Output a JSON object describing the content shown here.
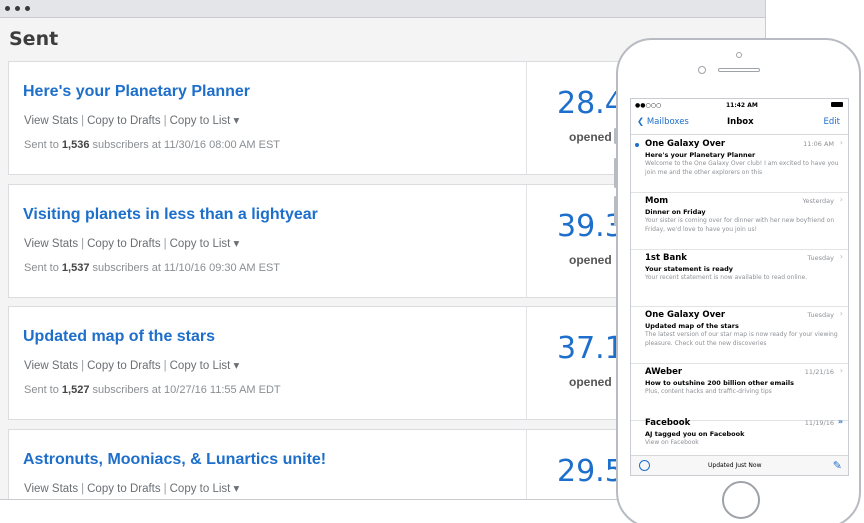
{
  "window": {
    "heading": "Sent"
  },
  "campaigns": [
    {
      "title": "Here's your Planetary Planner",
      "actions": [
        "View Stats",
        "Copy to Drafts",
        "Copy to List ▾"
      ],
      "sent_prefix": "Sent to ",
      "subscribers": "1,536",
      "sent_suffix": " subscribers at 11/30/16 08:00 AM EST",
      "stat": "28.4",
      "stat_label": "opened"
    },
    {
      "title": "Visiting planets in less than a lightyear",
      "actions": [
        "View Stats",
        "Copy to Drafts",
        "Copy to List ▾"
      ],
      "sent_prefix": "Sent to ",
      "subscribers": "1,537",
      "sent_suffix": " subscribers at 11/10/16 09:30 AM EST",
      "stat": "39.3",
      "stat_label": "opened"
    },
    {
      "title": "Updated map of the stars",
      "actions": [
        "View Stats",
        "Copy to Drafts",
        "Copy to List ▾"
      ],
      "sent_prefix": "Sent to ",
      "subscribers": "1,527",
      "sent_suffix": " subscribers at 10/27/16 11:55 AM EDT",
      "stat": "37.1",
      "stat_label": "opened"
    },
    {
      "title": "Astronuts, Mooniacs, & Lunartics unite!",
      "actions": [
        "View Stats",
        "Copy to Drafts",
        "Copy to List ▾"
      ],
      "stat": "29.5"
    }
  ],
  "phone": {
    "status": {
      "carrier": "●●○○○",
      "time": "11:42 AM"
    },
    "nav": {
      "back": "Mailboxes",
      "title": "Inbox",
      "edit": "Edit"
    },
    "mails": [
      {
        "from": "One Galaxy Over",
        "date": "11:06 AM",
        "subject": "Here's your Planetary Planner",
        "preview": "Welcome to the One Galaxy Over club! I am excited to have you join me and the other explorers on this",
        "unread": true
      },
      {
        "from": "Mom",
        "date": "Yesterday",
        "subject": "Dinner on Friday",
        "preview": "Your sister is coming over for dinner with her new boyfriend on Friday, we'd love to have you join us!"
      },
      {
        "from": "1st Bank",
        "date": "Tuesday",
        "subject": "Your statement is ready",
        "preview": "Your recent statement is now available to read online."
      },
      {
        "from": "One Galaxy Over",
        "date": "Tuesday",
        "subject": "Updated map of the stars",
        "preview": "The latest version of our star map is now ready for your viewing pleasure. Check out the new discoveries"
      },
      {
        "from": "AWeber",
        "date": "11/21/16",
        "subject": "How to outshine 200 billion other emails",
        "preview": "Plus, content hacks and traffic-driving tips"
      },
      {
        "from": "Facebook",
        "date": "11/19/16",
        "subject": "AJ tagged you on Facebook",
        "preview": "View on Facebook"
      }
    ],
    "toolbar": {
      "updated": "Updated Just Now"
    }
  }
}
